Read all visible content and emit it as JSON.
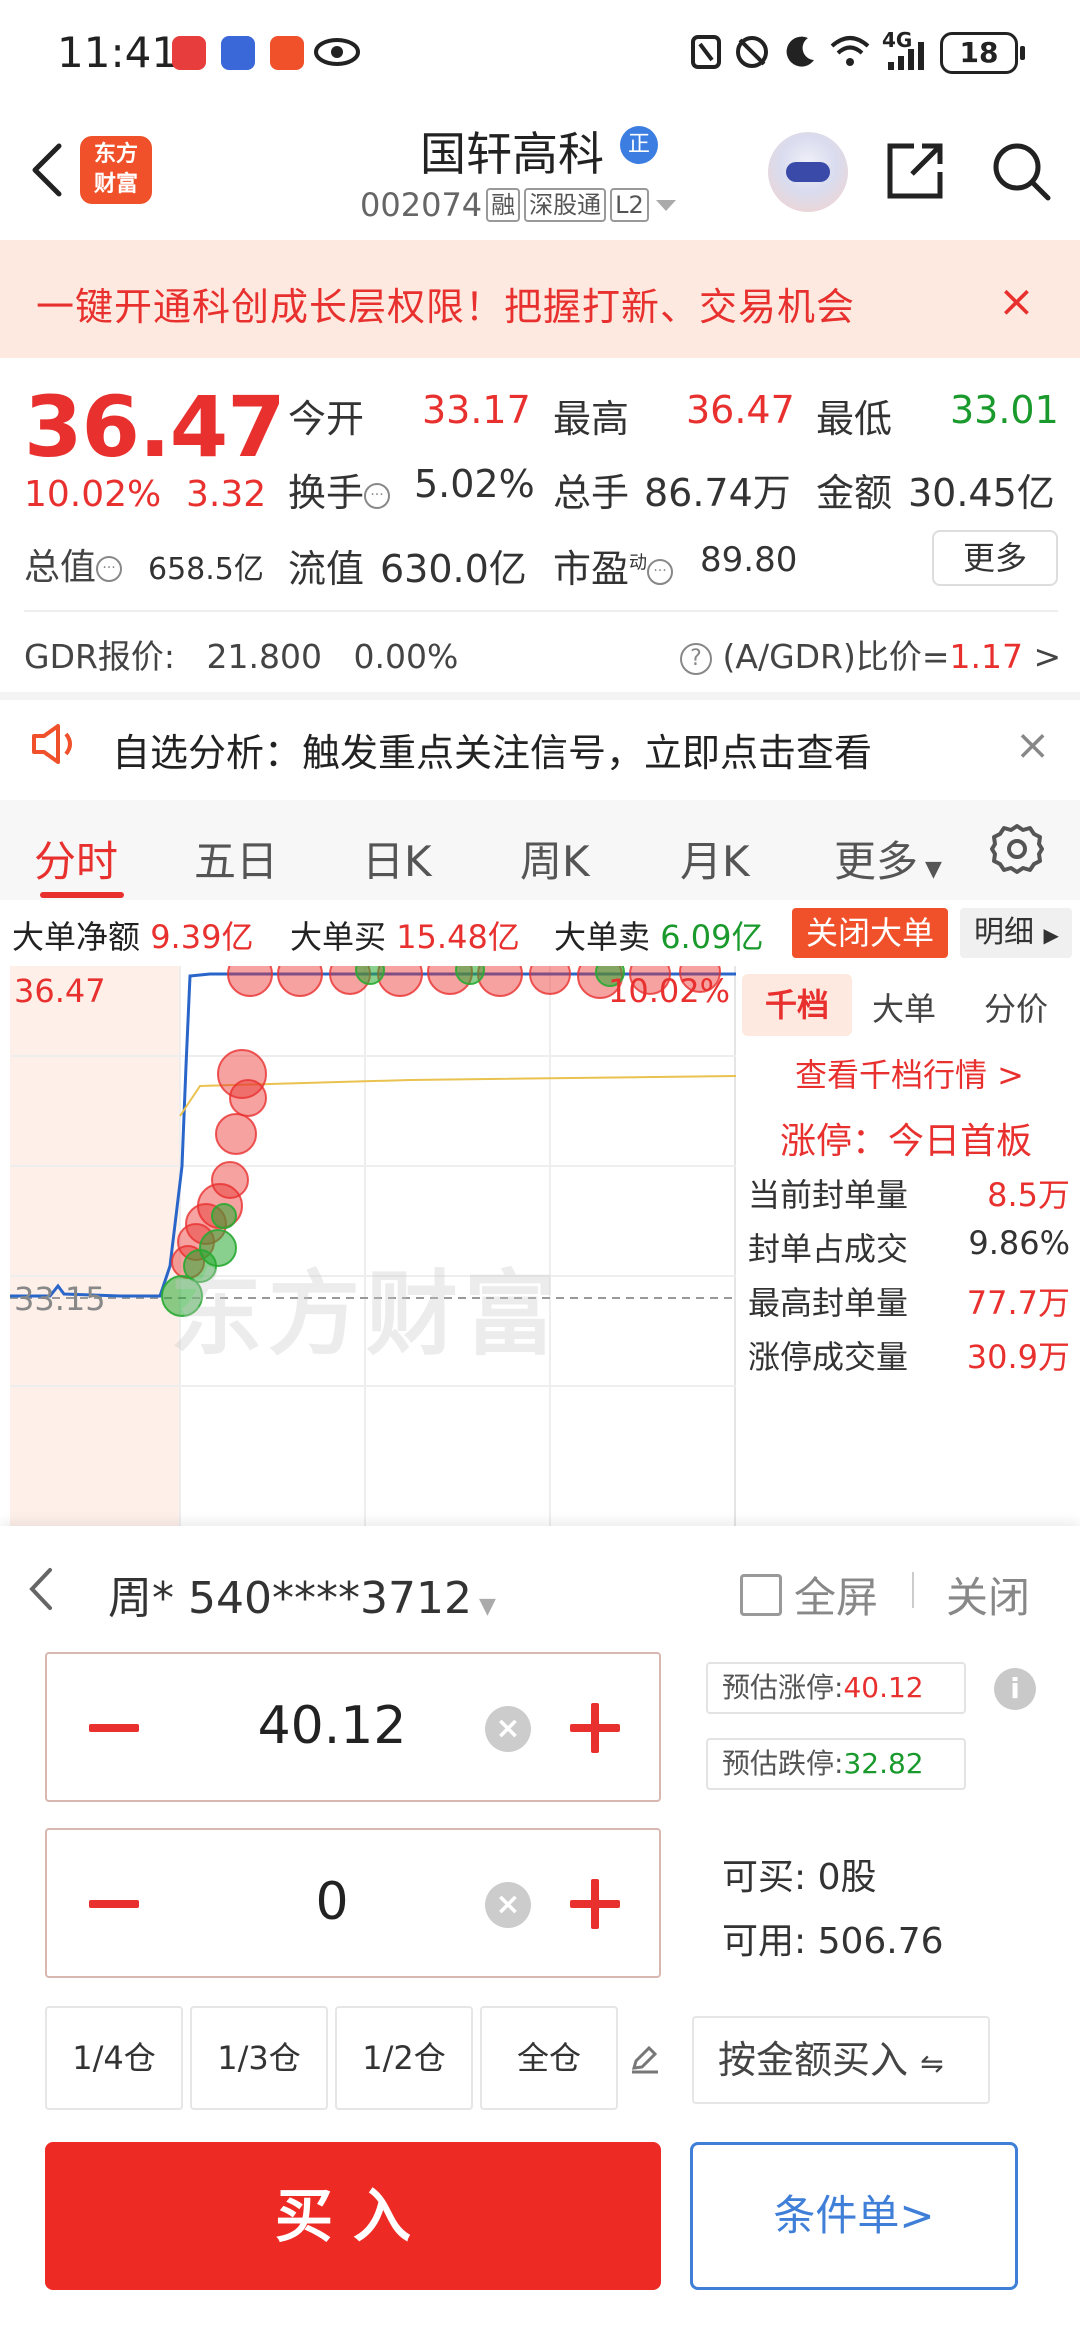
{
  "status_bar": {
    "time": "11:41",
    "network": "4G",
    "battery": "18"
  },
  "header": {
    "logo_text": "东方财富",
    "stock_name": "国轩高科",
    "name_badge": "正",
    "stock_code": "002074",
    "tags": [
      "融",
      "深股通",
      "L2"
    ]
  },
  "banner": {
    "text": "一键开通科创成长层权限！把握打新、交易机会",
    "close": "×"
  },
  "quote": {
    "price": "36.47",
    "change_pct": "10.02%",
    "change_amt": "3.32",
    "open_label": "今开",
    "open": "33.17",
    "high_label": "最高",
    "high": "36.47",
    "low_label": "最低",
    "low": "33.01",
    "turnover_label": "换手",
    "turnover": "5.02%",
    "volume_label": "总手",
    "volume": "86.74万",
    "amount_label": "金额",
    "amount": "30.45亿",
    "mktcap_label": "总值",
    "mktcap": "658.5亿",
    "float_label": "流值",
    "float": "630.0亿",
    "pe_label": "市盈",
    "pe_sup": "动",
    "pe": "89.80",
    "more": "更多"
  },
  "gdr": {
    "label": "GDR报价:",
    "price": "21.800",
    "pct": "0.00%",
    "ratio_label": "(A/GDR)比价=",
    "ratio": "1.17",
    "arrow": ">"
  },
  "alert": {
    "text": "自选分析：触发重点关注信号，立即点击查看"
  },
  "tabs": [
    "分时",
    "五日",
    "日K",
    "周K",
    "月K",
    "更多"
  ],
  "big_orders": {
    "net_label": "大单净额",
    "net": "9.39亿",
    "buy_label": "大单买",
    "buy": "15.48亿",
    "sell_label": "大单卖",
    "sell": "6.09亿",
    "close_btn": "关闭大单",
    "detail_btn": "明细"
  },
  "chart_data": {
    "type": "line",
    "price_top": "36.47",
    "price_base": "33.15",
    "pct_top": "10.02%",
    "watermark": "东方财富"
  },
  "right_panel": {
    "tabs": [
      "千档",
      "大单",
      "分价"
    ],
    "link": "查看千档行情 >",
    "limit_status": "涨停：今日首板",
    "rows": [
      {
        "label": "当前封单量",
        "value": "8.5万"
      },
      {
        "label": "封单占成交",
        "value": "9.86%"
      },
      {
        "label": "最高封单量",
        "value": "77.7万"
      },
      {
        "label": "涨停成交量",
        "value": "30.9万"
      }
    ]
  },
  "trade": {
    "account": "周* 540****3712",
    "fullscreen": "全屏",
    "close": "关闭",
    "price_value": "40.12",
    "qty_value": "0",
    "est_up_label": "预估涨停:",
    "est_up": "40.12",
    "est_down_label": "预估跌停:",
    "est_down": "32.82",
    "can_buy_label": "可买:",
    "can_buy": "0股",
    "available_label": "可用:",
    "available": "506.76",
    "positions": [
      "1/4仓",
      "1/3仓",
      "1/2仓",
      "全仓"
    ],
    "by_amount": "按金额买入",
    "buy": "买入",
    "conditional": "条件单>"
  }
}
